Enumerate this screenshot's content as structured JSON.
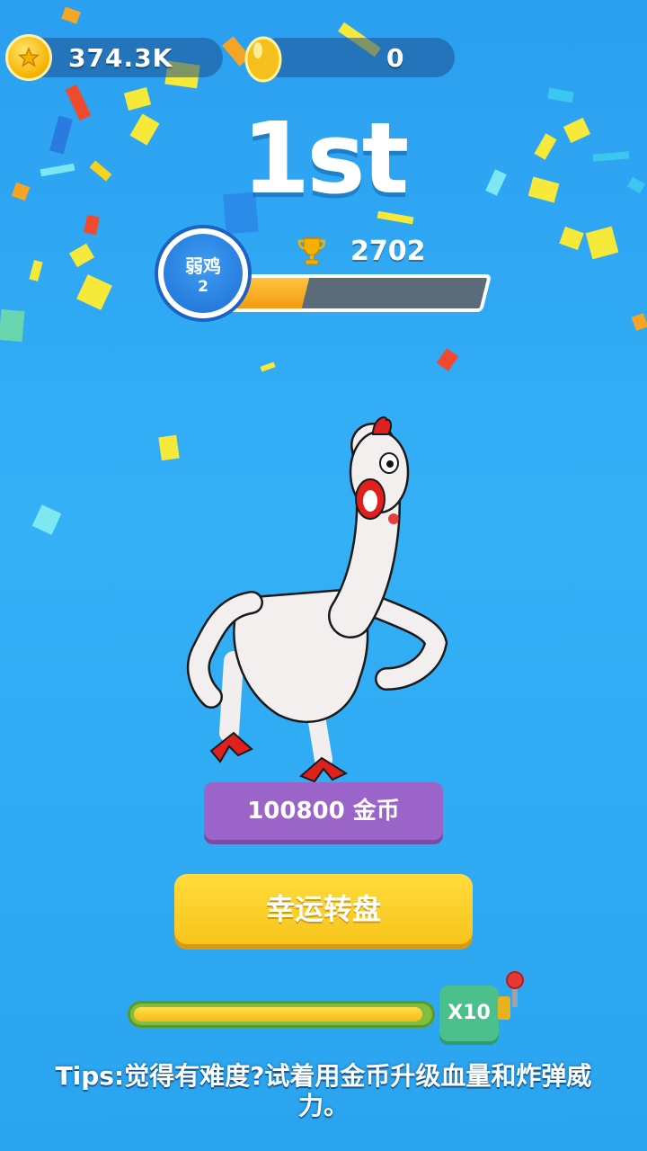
{
  "currency": {
    "coins": "374.3K",
    "eggs": "0"
  },
  "result": {
    "rank": "1st",
    "trophies": "2702",
    "rank_name": "弱鸡",
    "rank_level": "2",
    "progress_fraction": 0.35
  },
  "reward": {
    "amount_label": "100800 金币",
    "lucky_wheel_label": "幸运转盘",
    "multiplier_label": "X10",
    "multiplier_fraction": 0.98
  },
  "tips": "Tips:觉得有难度?试着用金币升级血量和炸弹威力。",
  "colors": {
    "background": "#34b0f7",
    "reward_purple": "#9b64c9",
    "button_yellow": "#f8c41c",
    "progress_orange": "#f39a12",
    "multiplier_green": "#4bbf8c"
  },
  "icons": [
    "coin-icon",
    "golden-egg-icon",
    "trophy-icon",
    "lever-icon"
  ]
}
